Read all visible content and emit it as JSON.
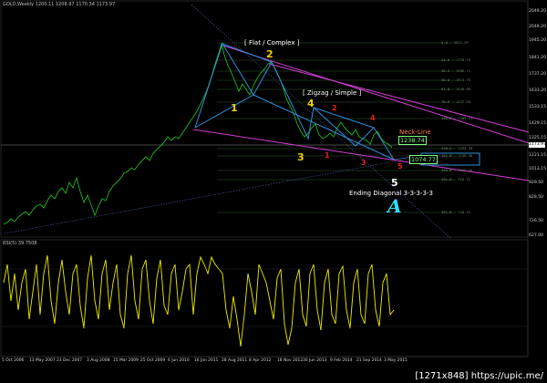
{
  "header": {
    "symbol_line": "GOLD,Weekly  1200.11 1208.97 1170.34 1173.97"
  },
  "rsi_header": "RSI(5) 39.7508",
  "y_axis": [
    "2049.20",
    "1945.20",
    "1841.20",
    "1737.20",
    "1633.20",
    "1533.15",
    "1429.15",
    "1325.15",
    "1221.15",
    "1117.15",
    "1013.15",
    "929.50",
    "828.50",
    "726.50",
    "627.00"
  ],
  "current_price": "1173.97",
  "x_axis": [
    "5 Oct 2006",
    "13 May 2007",
    "23 Dec 2007",
    "3 Aug 2008",
    "15 Mar 2009",
    "25 Oct 2009",
    "6 Jun 2010",
    "16 Jan 2011",
    "28 Aug 2011",
    "8 Apr 2012",
    "18 Nov 2012",
    "30 Jun 2013",
    "9 Feb 2014",
    "21 Sep 2014",
    "3 May 2015"
  ],
  "fib_levels": [
    "0.0 - 1923.29",
    "23.6 - 1776.79",
    "38.2 - 1686.71",
    "50.0 - 1613.75",
    "61.8 - 1540.89",
    "78.6 - 1437.33",
    "100.0 - 1305.21",
    "138.2 - 1194.29",
    "161.8 - 1136.56",
    "200.0 - 1022.44",
    "261.8 - 916.22",
    "361.8 - 726.31"
  ],
  "annotations": {
    "flat_complex": "[ Flat / Complex ]",
    "zigzag_simple": "[ Zigzag / Simple ]",
    "neck_line": "Neck-Line",
    "ending_diagonal": "Ending Diagonal 3-3-3-3-3",
    "big_a": "A"
  },
  "wave_labels": {
    "w1": "1",
    "w2": "2",
    "w3": "3",
    "w4": "4",
    "w5": "5",
    "r1": "1",
    "r2": "2",
    "r3": "3",
    "r4": "4",
    "r5": "5"
  },
  "price_boxes": {
    "neck": "1238.74",
    "low": "1074.77"
  },
  "watermark": "[1271x848] https://upic.me/",
  "colors": {
    "price": "#1fb81f",
    "magenta": "#e040e0",
    "blue": "#2f8fd8",
    "rsi": "#f0f000",
    "grid": "#2a2a2a"
  }
}
